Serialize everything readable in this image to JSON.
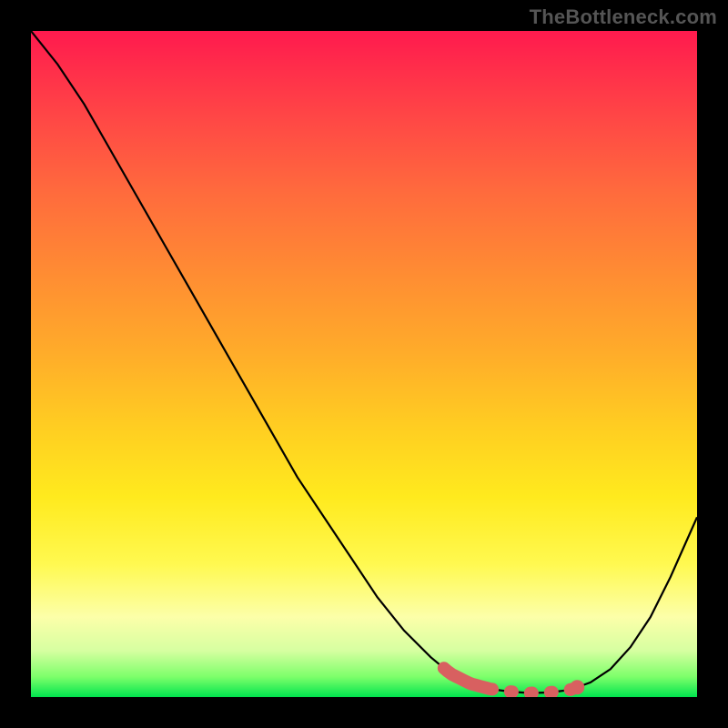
{
  "watermark": "TheBottleneck.com",
  "colors": {
    "curve": "#000000",
    "highlight": "#d86060",
    "gradient_top": "#ff1a4e",
    "gradient_bottom": "#00e44e"
  },
  "chart_data": {
    "type": "line",
    "title": "",
    "xlabel": "",
    "ylabel": "",
    "xlim": [
      0,
      100
    ],
    "ylim": [
      0,
      100
    ],
    "x": [
      0,
      4,
      8,
      12,
      16,
      20,
      24,
      28,
      32,
      36,
      40,
      44,
      48,
      52,
      56,
      60,
      63,
      66,
      69,
      72,
      75,
      78,
      81,
      84,
      87,
      90,
      93,
      96,
      100
    ],
    "y": [
      100,
      95,
      89,
      82,
      75,
      68,
      61,
      54,
      47,
      40,
      33,
      27,
      21,
      15,
      10,
      6,
      3.5,
      2,
      1.2,
      0.8,
      0.6,
      0.7,
      1.1,
      2.2,
      4.2,
      7.5,
      12,
      18,
      27
    ],
    "optimal_range_x": [
      62,
      82
    ],
    "marker_x": 82,
    "axes_visible": false,
    "grid": false,
    "background": "vertical gradient red→yellow→green"
  }
}
